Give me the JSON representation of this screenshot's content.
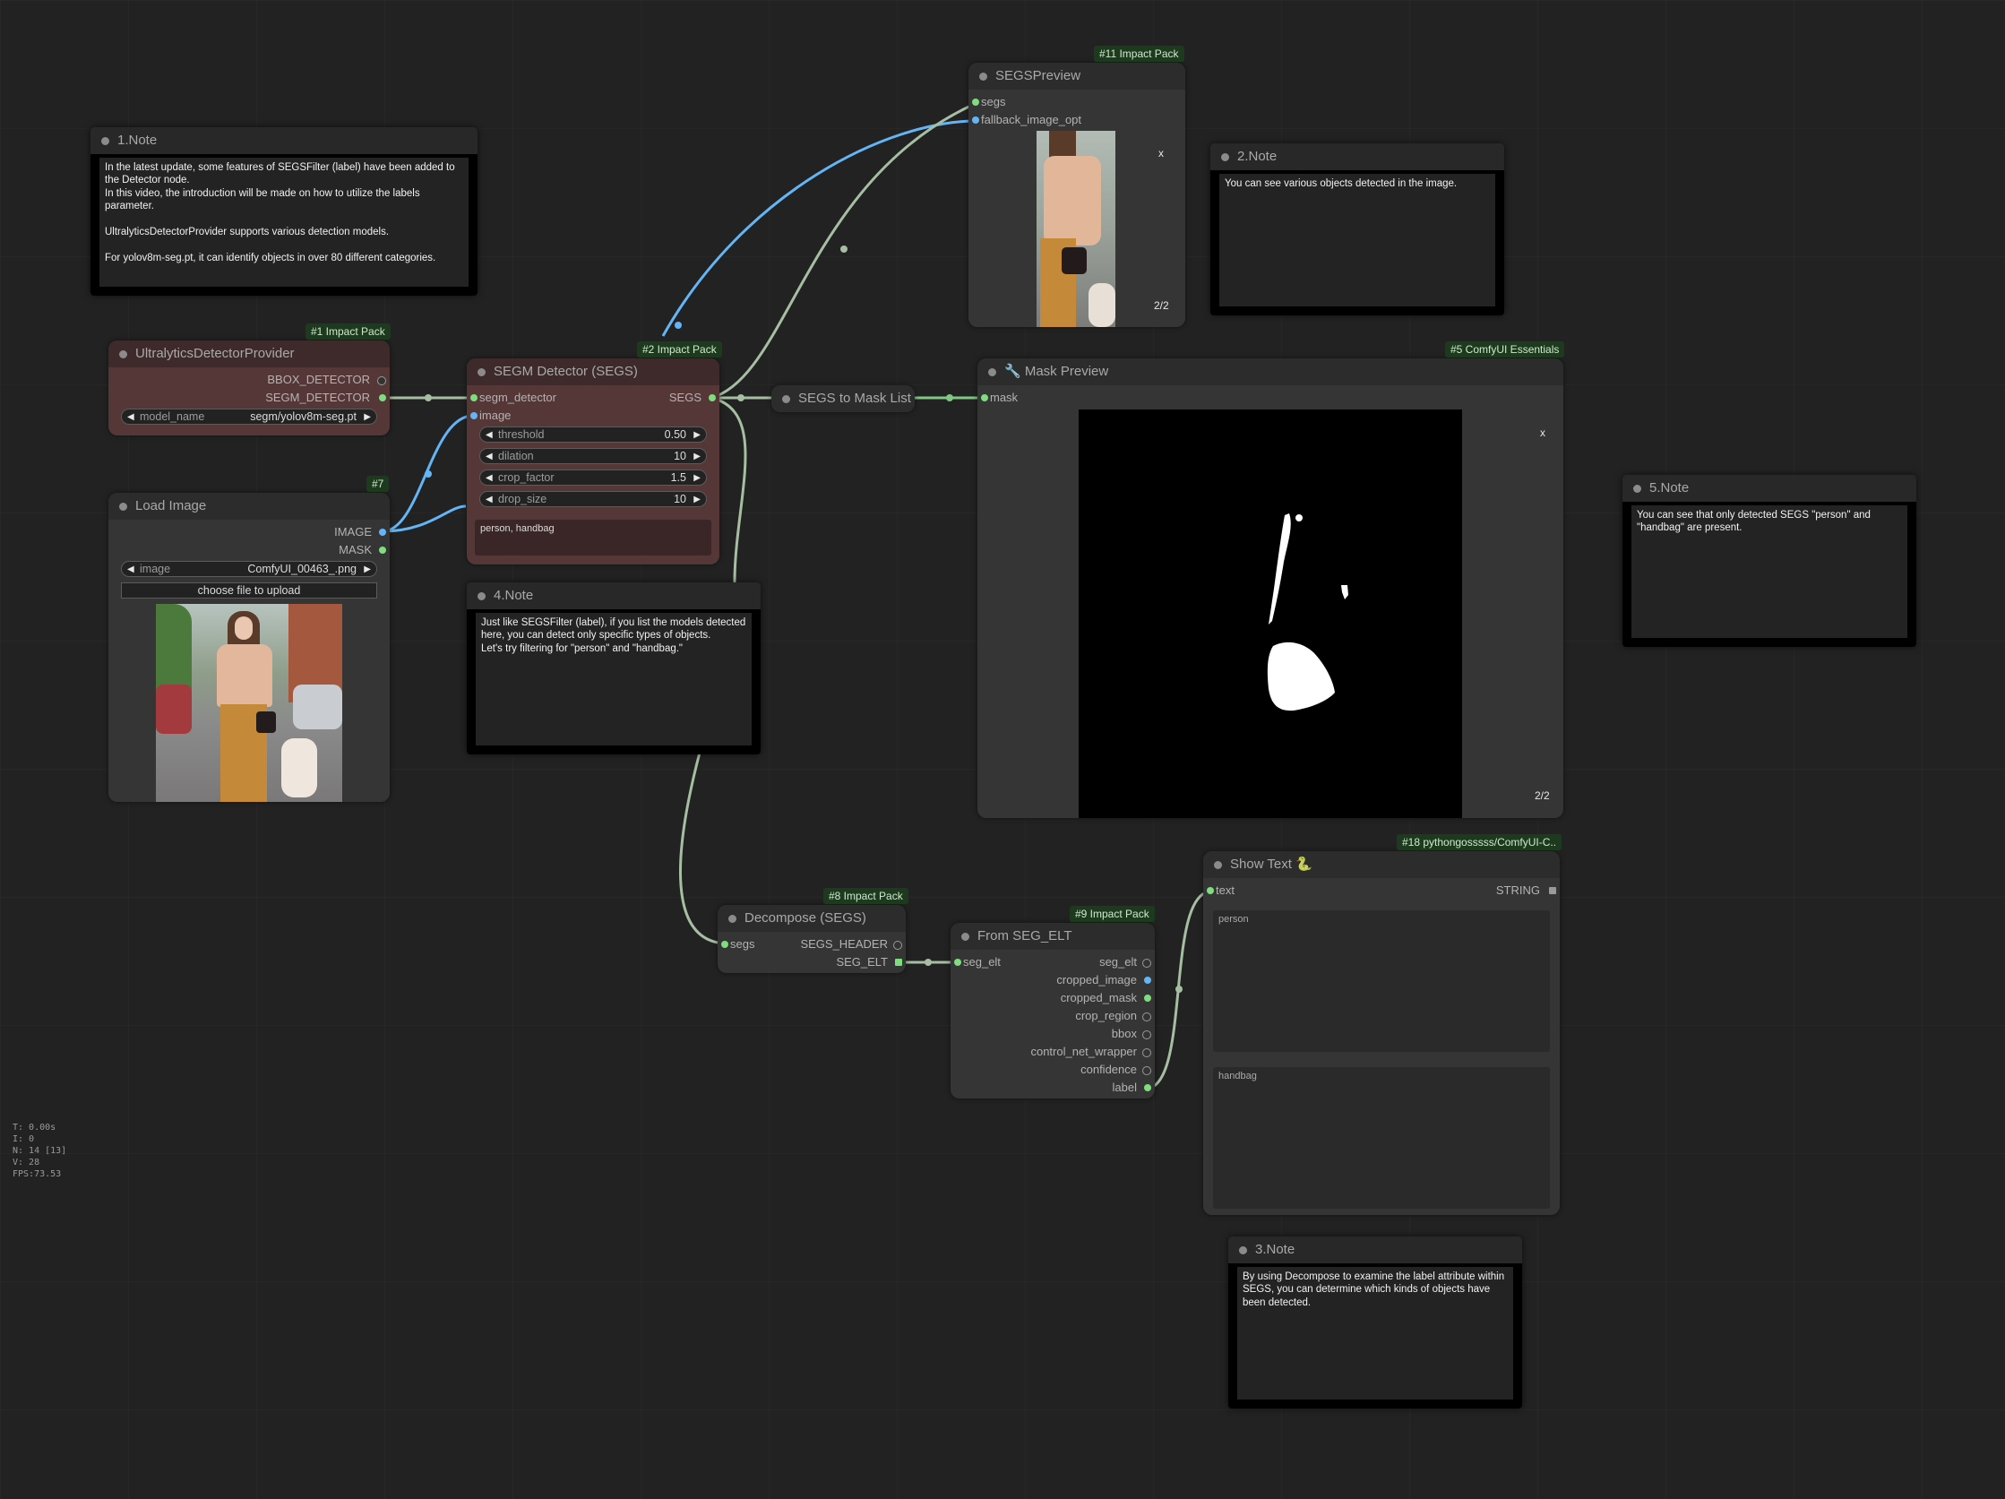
{
  "colors": {
    "canvas": "#222222",
    "node_bg": "#353535",
    "node_red_bg": "#553737",
    "badge_bg": "#1d3a1f",
    "link_image": "#64b5f6",
    "link_segs": "#a6bfa2",
    "link_mask": "#81c784",
    "pin_green": "#7fdc7f",
    "pin_blue": "#64b5f6",
    "pin_grey": "#9a9a9a"
  },
  "badges": {
    "b1": "#1 Impact Pack",
    "b2": "#2 Impact Pack",
    "b5": "#5 ComfyUI Essentials",
    "b7": "#7",
    "b8": "#8 Impact Pack",
    "b9": "#9 Impact Pack",
    "b11": "#11 Impact Pack",
    "b18": "#18 pythongosssss/ComfyUI-C.."
  },
  "note1": {
    "title": "1.Note",
    "text": "In the latest update, some features of SEGSFilter (label) have been added to the Detector node.\nIn this video, the introduction will be made on how to utilize the labels parameter.\n\nUltralyticsDetectorProvider supports various detection models.\n\nFor yolov8m-seg.pt, it can identify objects in over 80 different categories."
  },
  "note2": {
    "title": "2.Note",
    "text": "You can see various objects detected in the image."
  },
  "note3": {
    "title": "3.Note",
    "text": "By using Decompose to examine the label attribute within SEGS, you can determine which kinds of objects have been detected."
  },
  "note4": {
    "title": "4.Note",
    "text": "Just like SEGSFilter (label), if you list the models detected here, you can detect only specific types of objects.\nLet's try filtering for \"person\" and \"handbag.\""
  },
  "note5": {
    "title": "5.Note",
    "text": "You can see that only detected SEGS \"person\" and \"handbag\" are present."
  },
  "ultra": {
    "title": "UltralyticsDetectorProvider",
    "out_bbox": "BBOX_DETECTOR",
    "out_segm": "SEGM_DETECTOR",
    "w_name": "model_name",
    "w_value": "segm/yolov8m-seg.pt"
  },
  "load": {
    "title": "Load Image",
    "out_image": "IMAGE",
    "out_mask": "MASK",
    "w_name": "image",
    "w_value": "ComfyUI_00463_.png",
    "upload": "choose file to upload"
  },
  "segm": {
    "title": "SEGM Detector (SEGS)",
    "in_detector": "segm_detector",
    "in_image": "image",
    "out_segs": "SEGS",
    "widgets": [
      {
        "name": "threshold",
        "value": "0.50"
      },
      {
        "name": "dilation",
        "value": "10"
      },
      {
        "name": "crop_factor",
        "value": "1.5"
      },
      {
        "name": "drop_size",
        "value": "10"
      }
    ],
    "labels": "person, handbag"
  },
  "segs2mask": {
    "title": "SEGS to Mask List"
  },
  "preview": {
    "title": "SEGSPreview",
    "in_segs": "segs",
    "in_fallback": "fallback_image_opt",
    "close": "x",
    "counter": "2/2"
  },
  "maskprev": {
    "title": "🔧 Mask Preview",
    "in_mask": "mask",
    "close": "x",
    "counter": "2/2"
  },
  "decompose": {
    "title": "Decompose (SEGS)",
    "in_segs": "segs",
    "out_header": "SEGS_HEADER",
    "out_elt": "SEG_ELT"
  },
  "fromelt": {
    "title": "From SEG_ELT",
    "in_elt": "seg_elt",
    "outputs": [
      "seg_elt",
      "cropped_image",
      "cropped_mask",
      "crop_region",
      "bbox",
      "control_net_wrapper",
      "confidence",
      "label"
    ]
  },
  "showtext": {
    "title": "Show Text 🐍",
    "in_text": "text",
    "out_string": "STRING",
    "texts": [
      "person",
      "handbag"
    ]
  },
  "stats": {
    "t": "T: 0.00s",
    "i": "I: 0",
    "n": "N: 14 [13]",
    "v": "V: 28",
    "fps": "FPS:73.53"
  }
}
